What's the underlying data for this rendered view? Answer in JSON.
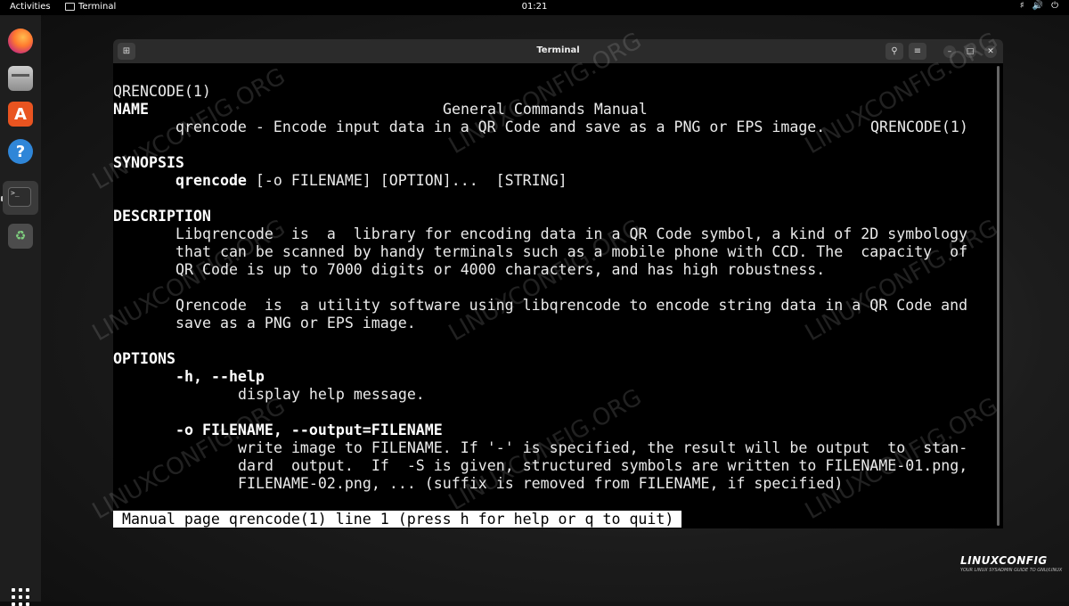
{
  "topbar": {
    "activities": "Activities",
    "app_name": "Terminal",
    "clock": "01:21",
    "tray_icons": [
      "network-icon",
      "volume-icon",
      "power-icon"
    ]
  },
  "dock": {
    "items": [
      "firefox-icon",
      "files-icon",
      "software-center-icon",
      "help-icon",
      "terminal-icon",
      "trash-icon",
      "show-apps-icon"
    ]
  },
  "window": {
    "title": "Terminal",
    "buttons": [
      "new-tab-icon",
      "search-icon",
      "menu-icon",
      "minimize-icon",
      "maximize-icon",
      "close-icon"
    ]
  },
  "manpage": {
    "header_left": "QRENCODE(1)",
    "header_center": "General Commands Manual",
    "header_right": "QRENCODE(1)",
    "name_heading": "NAME",
    "name_text": "qrencode - Encode input data in a QR Code and save as a PNG or EPS image.",
    "synopsis_heading": "SYNOPSIS",
    "synopsis_cmd": "qrencode",
    "synopsis_args": " [-o FILENAME] [OPTION]...  [STRING]",
    "description_heading": "DESCRIPTION",
    "desc_lines": [
      "Libqrencode  is  a  library for encoding data in a QR Code symbol, a kind of 2D symbology",
      "that can be scanned by handy terminals such as a mobile phone with CCD. The  capacity  of",
      "QR Code is up to 7000 digits or 4000 characters, and has high robustness.",
      "Qrencode  is  a utility software using libqrencode to encode string data in a QR Code and",
      "save as a PNG or EPS image."
    ],
    "options_heading": "OPTIONS",
    "opt_help": "-h, --help",
    "opt_help_desc": "display help message.",
    "opt_output": "-o FILENAME, --output=FILENAME",
    "opt_output_lines": [
      "write image to FILENAME. If '-' is specified, the result will be output  to  stan-",
      "dard  output.  If  -S is given, structured symbols are written to FILENAME-01.png,",
      "FILENAME-02.png, ... (suffix is removed from FILENAME, if specified)"
    ],
    "status_line": "Manual page qrencode(1) line 1 (press h for help or q to quit)"
  },
  "branding": {
    "logo": "LINUXCONFIG",
    "tagline": "YOUR LINUX SYSADMIN GUIDE TO GNU/LINUX",
    "watermark": "LINUXCONFIG.ORG"
  }
}
